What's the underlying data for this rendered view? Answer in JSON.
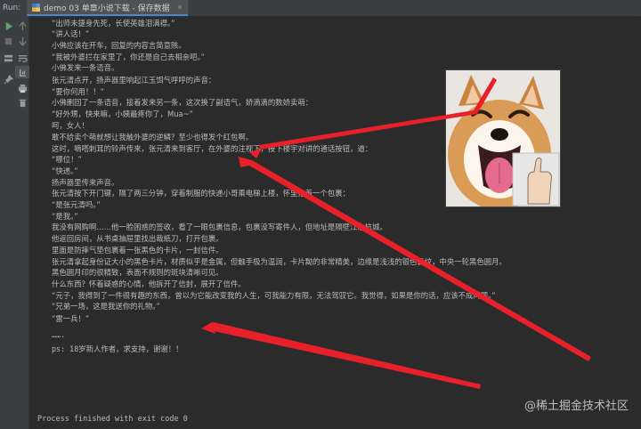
{
  "tabbar": {
    "run_label": "Run:",
    "tab_label": "demo 03 单章小说下载 - 保存数据"
  },
  "toolbar": {
    "buttons": [
      "rerun-icon",
      "up-arrow-icon",
      "stop-icon",
      "down-arrow-icon",
      "layout-icon",
      "soft-wrap-icon",
      "scroll-end-icon",
      "pin-icon",
      "print-icon",
      "trash-icon"
    ]
  },
  "console": {
    "lines": [
      "“出师未捷身先死，长使英雄泪满襟。”",
      "“讲人话！”",
      "小佛应该在开车，回复的内容言简意赅。",
      "“我被外婆拦在家里了，你还是自己去相亲吧。”",
      "小佛发来一条语音。",
      "张元清点开，扬声器里响起江玉饵气呼呼的声音：",
      "“要你何用！！”",
      "小佛删回了一条语音，接着发来另一条，这次换了副语气，娇滴滴的数娇卖萌：",
      "“好外甥，快来嘛，小姨最疼你了，Mua~”",
      "呵，女人！",
      "敢不给卖个萌就想让我触外婆的逆鳞？至少也得发个红包啊。",
      "这时，嘀嗒刺耳的铃声传来，张元清来到客厅，在外婆的注视下，按下楼宇对讲的通话按钮，道：",
      "“哪位！”",
      "“快递。”",
      "扬声器里传来声音。",
      "张元清按下开门键，隔了两三分钟，穿着制服的快递小哥乘电梯上楼，怀里抱着一个包裹：",
      "“是张元清吗。”",
      "“是我。”",
      "我没有网购啊……他一脸困惑的签收，看了一眼包裹信息，包裹没写寄件人，但地址是隔壁江水杭城。",
      "他返回房间，从书桌抽屉里找出裁纸刀，打开包裹。",
      "里面是防摔气垫包裹着一张黑色的卡片，一封信件。",
      "张元清拿起身份证大小的黑色卡片，材质似乎是金属，但触手极为温润，卡片黝的非常精美，边缘是浅浅的银色云纹，中央一轮黑色圆月。",
      "黑色圆月印的很精致，表面不规则的斑块清晰可见。",
      "什么东西？怀着疑惑的心情，他拆开了信封，展开了信件。",
      "“元子，我得到了一件很有趣的东西，曾以为它能改变我的人生，可我能力有限，无法驾驭它。我觉得，如果是你的话，应该不成问题。”",
      "“兄弟一场，这是我送你的礼物。”",
      "“雷一兵！”",
      "…….",
      "ps: 18岁新人作者，求支持，谢谢！！"
    ],
    "finish_text": "Process finished with exit code 0"
  },
  "watermark": "@稀土掘金技术社区",
  "colors": {
    "background": "#2b2b2b",
    "panel": "#3c3f41",
    "text": "#bbbbbb",
    "arrow": "#e8202a"
  }
}
